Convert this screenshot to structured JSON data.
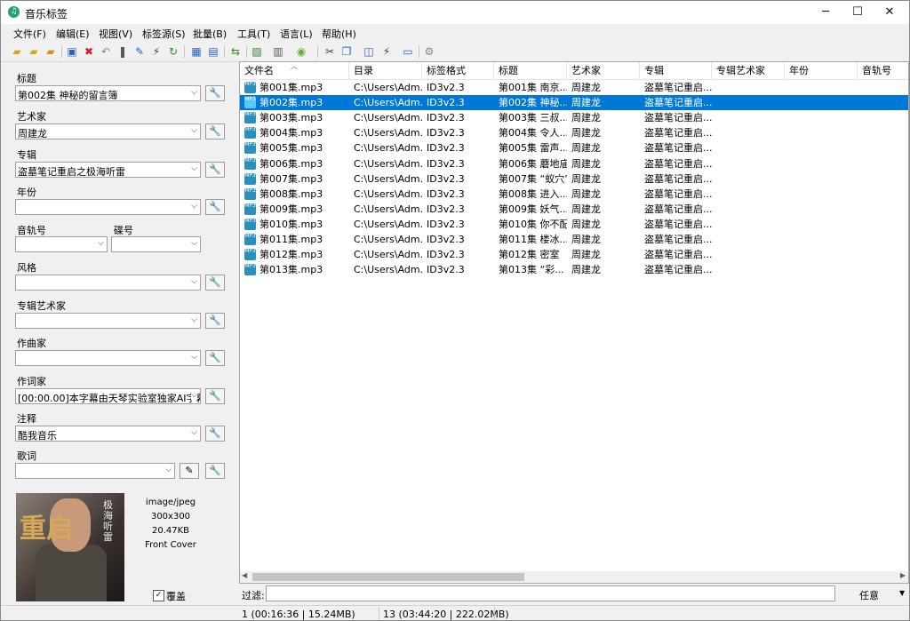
{
  "window": {
    "title": "音乐标签",
    "min": "─",
    "max": "☐",
    "close": "✕"
  },
  "menu": [
    "文件(F)",
    "编辑(E)",
    "视图(V)",
    "标签源(S)",
    "批量(B)",
    "工具(T)",
    "语言(L)",
    "帮助(H)"
  ],
  "fields": {
    "title": {
      "label": "标题",
      "value": "第002集 神秘的留言簿"
    },
    "artist": {
      "label": "艺术家",
      "value": "周建龙"
    },
    "album": {
      "label": "专辑",
      "value": "盗墓笔记重启之极海听雷"
    },
    "year": {
      "label": "年份",
      "value": ""
    },
    "track": {
      "label": "音轨号",
      "value": ""
    },
    "disc": {
      "label": "碟号",
      "value": ""
    },
    "genre": {
      "label": "风格",
      "value": ""
    },
    "album_artist": {
      "label": "专辑艺术家",
      "value": ""
    },
    "composer": {
      "label": "作曲家",
      "value": ""
    },
    "lyricist": {
      "label": "作词家",
      "value": "[00:00.00]本字幕由天琴实验室独家AI字幕技"
    },
    "comment": {
      "label": "注释",
      "value": "酷我音乐"
    },
    "lyrics": {
      "label": "歌词",
      "value": ""
    }
  },
  "cover": {
    "big_text": "重启",
    "side_text": "极海听雷",
    "mime": "image/jpeg",
    "dims": "300x300",
    "size": "20.47KB",
    "type": "Front Cover",
    "overwrite_label": "覆盖",
    "overwrite_checked": "✓"
  },
  "columns": [
    "文件名",
    "目录",
    "标签格式",
    "标题",
    "艺术家",
    "专辑",
    "专辑艺术家",
    "年份",
    "音轨号"
  ],
  "rows": [
    {
      "file": "第001集.mp3",
      "dir": "C:\\Users\\Adm...",
      "fmt": "ID3v2.3",
      "title": "第001集 南京...",
      "artist": "周建龙",
      "album": "盗墓笔记重启..."
    },
    {
      "file": "第002集.mp3",
      "dir": "C:\\Users\\Adm...",
      "fmt": "ID3v2.3",
      "title": "第002集 神秘...",
      "artist": "周建龙",
      "album": "盗墓笔记重启...",
      "selected": true
    },
    {
      "file": "第003集.mp3",
      "dir": "C:\\Users\\Adm...",
      "fmt": "ID3v2.3",
      "title": "第003集 三叔...",
      "artist": "周建龙",
      "album": "盗墓笔记重启..."
    },
    {
      "file": "第004集.mp3",
      "dir": "C:\\Users\\Adm...",
      "fmt": "ID3v2.3",
      "title": "第004集 令人...",
      "artist": "周建龙",
      "album": "盗墓笔记重启..."
    },
    {
      "file": "第005集.mp3",
      "dir": "C:\\Users\\Adm...",
      "fmt": "ID3v2.3",
      "title": "第005集 雷声...",
      "artist": "周建龙",
      "album": "盗墓笔记重启..."
    },
    {
      "file": "第006集.mp3",
      "dir": "C:\\Users\\Adm...",
      "fmt": "ID3v2.3",
      "title": "第006集 蘑地庙",
      "artist": "周建龙",
      "album": "盗墓笔记重启..."
    },
    {
      "file": "第007集.mp3",
      "dir": "C:\\Users\\Adm...",
      "fmt": "ID3v2.3",
      "title": "第007集 “蚁穴”",
      "artist": "周建龙",
      "album": "盗墓笔记重启..."
    },
    {
      "file": "第008集.mp3",
      "dir": "C:\\Users\\Adm...",
      "fmt": "ID3v2.3",
      "title": "第008集 进入...",
      "artist": "周建龙",
      "album": "盗墓笔记重启..."
    },
    {
      "file": "第009集.mp3",
      "dir": "C:\\Users\\Adm...",
      "fmt": "ID3v2.3",
      "title": "第009集 妖气...",
      "artist": "周建龙",
      "album": "盗墓笔记重启..."
    },
    {
      "file": "第010集.mp3",
      "dir": "C:\\Users\\Adm...",
      "fmt": "ID3v2.3",
      "title": "第010集 你不配",
      "artist": "周建龙",
      "album": "盗墓笔记重启..."
    },
    {
      "file": "第011集.mp3",
      "dir": "C:\\Users\\Adm...",
      "fmt": "ID3v2.3",
      "title": "第011集 楼冰...",
      "artist": "周建龙",
      "album": "盗墓笔记重启..."
    },
    {
      "file": "第012集.mp3",
      "dir": "C:\\Users\\Adm...",
      "fmt": "ID3v2.3",
      "title": "第012集 密室",
      "artist": "周建龙",
      "album": "盗墓笔记重启..."
    },
    {
      "file": "第013集.mp3",
      "dir": "C:\\Users\\Adm...",
      "fmt": "ID3v2.3",
      "title": "第013集 “彩...",
      "artist": "周建龙",
      "album": "盗墓笔记重启..."
    }
  ],
  "mp3_badge": "MP3",
  "filter": {
    "label": "过滤:",
    "value": "",
    "mode": "任意"
  },
  "status": {
    "selected": "1 (00:16:36 | 15.24MB)",
    "total": "13 (03:44:20 | 222.02MB)"
  },
  "colors": {
    "selection": "#0078d7",
    "accent": "#1fa56b"
  }
}
